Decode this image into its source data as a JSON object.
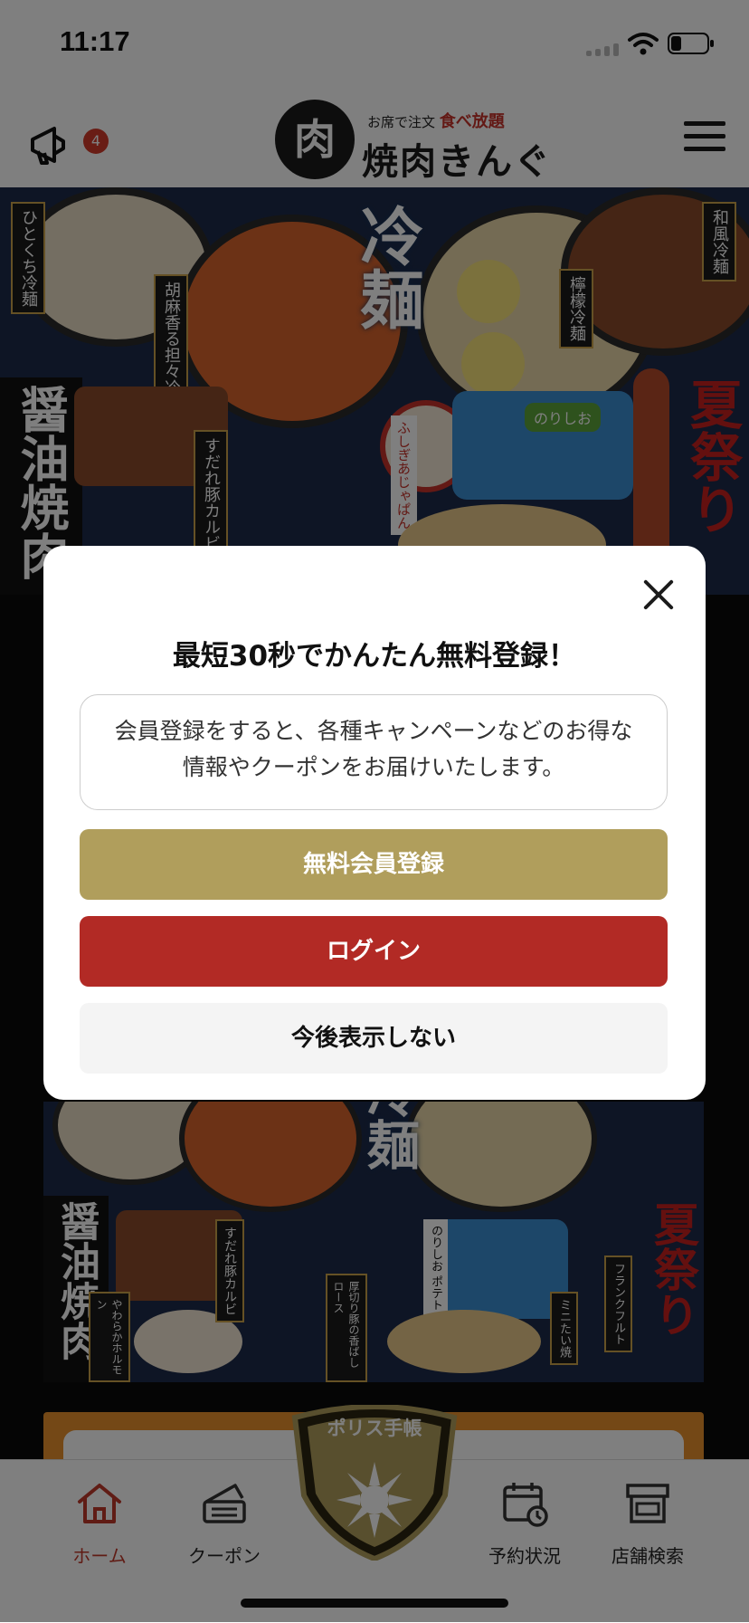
{
  "status_bar": {
    "time": "11:17"
  },
  "header": {
    "news_badge_count": "4",
    "logo_tagline_plain": "お席で注文 ",
    "logo_tagline_accent": "食べ放題",
    "logo_mark": "肉",
    "logo_name": "焼肉きんぐ"
  },
  "banner": {
    "main_title": "冷麺",
    "noodle_labels": [
      "ひとくち冷麺",
      "胡麻香る担々冷麺",
      "檸檬冷麺",
      "和風冷麺"
    ],
    "soy_title": "醤油焼肉",
    "summer_title": "夏祭り",
    "item_labels": [
      "すだれ豚カルビ",
      "やわらかホルモン",
      "厚切り豚の香ばしロース",
      "のりしお ポテトフライ",
      "ミニたい焼",
      "フランクフルト"
    ],
    "badge": "ふしぎあじゃぱん",
    "chip_label": "のりしお"
  },
  "modal": {
    "title": "最短30秒でかんたん無料登録！",
    "message": "会員登録をすると、各種キャンペーンなどのお得な情報やクーポンをお届けいたします。",
    "register_label": "無料会員登録",
    "login_label": "ログイン",
    "dismiss_label": "今後表示しない"
  },
  "tabbar": {
    "home": "ホーム",
    "coupon": "クーポン",
    "center": "ポリス手帳",
    "reservation": "予約状況",
    "store_search": "店舗検索"
  },
  "colors": {
    "register": "#b09e5c",
    "login": "#b22a25",
    "home_active": "#c0392b"
  }
}
